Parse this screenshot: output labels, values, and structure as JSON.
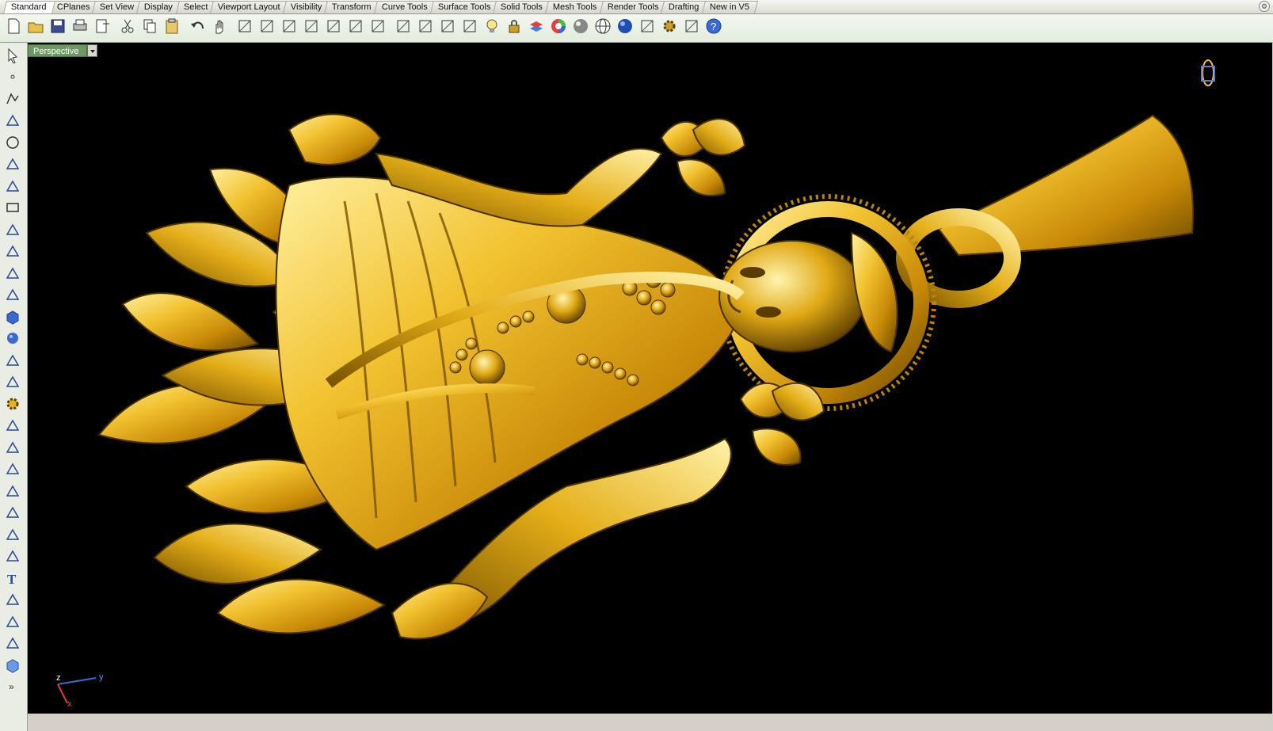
{
  "tabs": [
    {
      "label": "Standard",
      "active": true
    },
    {
      "label": "CPlanes"
    },
    {
      "label": "Set View"
    },
    {
      "label": "Display"
    },
    {
      "label": "Select"
    },
    {
      "label": "Viewport Layout"
    },
    {
      "label": "Visibility"
    },
    {
      "label": "Transform"
    },
    {
      "label": "Curve Tools"
    },
    {
      "label": "Surface Tools"
    },
    {
      "label": "Solid Tools"
    },
    {
      "label": "Mesh Tools"
    },
    {
      "label": "Render Tools"
    },
    {
      "label": "Drafting"
    },
    {
      "label": "New in V5"
    }
  ],
  "toolbar_icons": [
    "new-file-icon",
    "open-file-icon",
    "save-icon",
    "print-icon",
    "import-icon",
    "cut-icon",
    "copy-icon",
    "paste-icon",
    "undo-icon",
    "pan-icon",
    "rotate-view-icon",
    "zoom-window-icon",
    "zoom-dynamic-icon",
    "zoom-extents-icon",
    "zoom-selected-icon",
    "undo-view-icon",
    "four-viewports-icon",
    "car-icon",
    "hide-icon",
    "show-icon",
    "point-on-icon",
    "light-icon",
    "lock-icon",
    "layer-icon",
    "color-wheel-icon",
    "shaded-sphere-icon",
    "grid-sphere-icon",
    "render-sphere-icon",
    "select-filter-icon",
    "options-gear-icon",
    "snap-icon",
    "help-icon"
  ],
  "sidebar_icons": [
    "select-arrow-icon",
    "point-icon",
    "polyline-icon",
    "curve-icon",
    "circle-icon",
    "ellipse-icon",
    "polygon-icon",
    "rectangle-icon",
    "arc-icon",
    "fillet-icon",
    "surface-icon",
    "revolve-icon",
    "box-icon",
    "sphere-icon",
    "cylinder-icon",
    "mesh-icon",
    "gear-icon",
    "transform-icon",
    "trim-icon",
    "split-icon",
    "boolean-icon",
    "group-icon",
    "offset-icon",
    "blend-icon",
    "text-icon",
    "dimension-icon",
    "array-icon",
    "edit-icon",
    "solid-box-icon",
    "more-icon"
  ],
  "viewport": {
    "name": "Perspective"
  },
  "axes": {
    "x": "x",
    "y": "y",
    "z": "z"
  },
  "colors": {
    "viewport_bg": "#000000",
    "gold_light": "#ffe066",
    "gold_mid": "#d9a010",
    "gold_dark": "#6b4a00",
    "tab_green": "#6b9863"
  }
}
